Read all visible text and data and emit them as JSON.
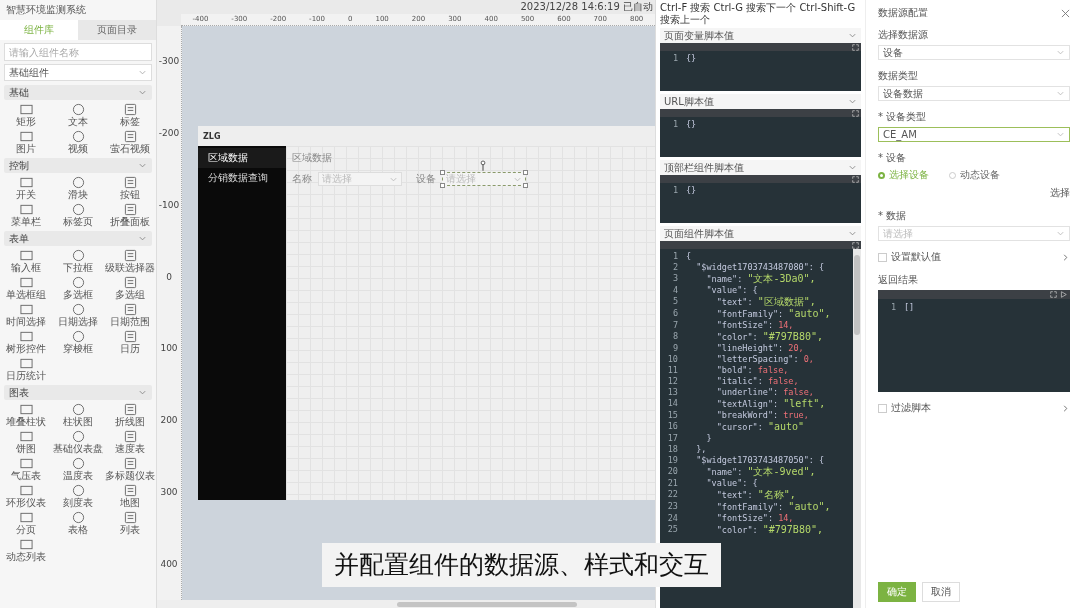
{
  "left_panel": {
    "title": "智慧环境监测系统",
    "tabs": [
      {
        "label": "组件库",
        "selected": true
      },
      {
        "label": "页面目录",
        "selected": false
      }
    ],
    "search": {
      "placeholder": "请输入组件名称"
    },
    "category": {
      "value": "基础组件"
    },
    "sections": [
      {
        "title": "基础",
        "items": [
          "矩形",
          "文本",
          "标签",
          "图片",
          "视频",
          "萤石视频"
        ]
      },
      {
        "title": "控制",
        "items": [
          "开关",
          "滑块",
          "按钮",
          "菜单栏",
          "标签页",
          "折叠面板"
        ]
      },
      {
        "title": "表单",
        "items": [
          "输入框",
          "下拉框",
          "级联选择器",
          "单选框组",
          "多选框",
          "多选组",
          "时间选择",
          "日期选择",
          "日期范围",
          "树形控件",
          "穿梭框",
          "日历",
          "日历统计"
        ]
      },
      {
        "title": "图表",
        "items": [
          "堆叠柱状",
          "柱状图",
          "折线图",
          "饼图",
          "基础仪表盘",
          "速度表",
          "气压表",
          "温度表",
          "多标题仪表",
          "环形仪表",
          "刻度表",
          "地图",
          "分页",
          "表格",
          "列表",
          "动态列表"
        ]
      }
    ]
  },
  "canvas": {
    "timestamp": "2023/12/28 14:6:19 已自动",
    "h_ruler": [
      "-400",
      "-300",
      "-200",
      "-100",
      "0",
      "100",
      "200",
      "300",
      "400",
      "500",
      "600",
      "700",
      "800"
    ],
    "v_ruler": [
      "-300",
      "-200",
      "-100",
      "0",
      "100",
      "200",
      "300",
      "400"
    ],
    "preview": {
      "logo": "ZLG",
      "menu": [
        {
          "label": "区域数据",
          "selected": true
        },
        {
          "label": "分销数据查询",
          "selected": false
        }
      ],
      "heading": "区域数据",
      "fields": [
        {
          "label": "名称",
          "placeholder": "请选择",
          "selected": false
        },
        {
          "label": "设备",
          "placeholder": "请选择",
          "selected": true
        }
      ]
    }
  },
  "script_panel": {
    "hint": "Ctrl-F 搜索 Ctrl-G 搜索下一个 Ctrl-Shift-G 搜索上一个",
    "editors": [
      {
        "title": "页面变量脚本值",
        "lines": [
          {
            "no": "1",
            "code": "{}"
          }
        ]
      },
      {
        "title": "URL脚本值",
        "lines": [
          {
            "no": "1",
            "code": "{}"
          }
        ]
      },
      {
        "title": "顶部栏组件脚本值",
        "lines": [
          {
            "no": "1",
            "code": "{}"
          }
        ]
      },
      {
        "title": "页面组件脚本值",
        "lines": [
          {
            "no": "1",
            "code": "{"
          },
          {
            "no": "2",
            "code": "  \"$widget1703743487080\": {"
          },
          {
            "no": "3",
            "code": "    \"name\": ",
            "value": "\"文本-3Da0\",",
            "kind": "string"
          },
          {
            "no": "4",
            "code": "    \"value\": {"
          },
          {
            "no": "5",
            "code": "      \"text\": ",
            "value": "\"区域数据\",",
            "kind": "string"
          },
          {
            "no": "6",
            "code": "      \"fontFamily\": ",
            "value": "\"auto\",",
            "kind": "string"
          },
          {
            "no": "7",
            "code": "      \"fontSize\": ",
            "value": "14,",
            "kind": "literal"
          },
          {
            "no": "8",
            "code": "      \"color\": ",
            "value": "\"#797B80\",",
            "kind": "string"
          },
          {
            "no": "9",
            "code": "      \"lineHeight\": ",
            "value": "20,",
            "kind": "literal"
          },
          {
            "no": "10",
            "code": "      \"letterSpacing\": ",
            "value": "0,",
            "kind": "literal"
          },
          {
            "no": "11",
            "code": "      \"bold\": ",
            "value": "false,",
            "kind": "literal"
          },
          {
            "no": "12",
            "code": "      \"italic\": ",
            "value": "false,",
            "kind": "literal"
          },
          {
            "no": "13",
            "code": "      \"underline\": ",
            "value": "false,",
            "kind": "literal"
          },
          {
            "no": "14",
            "code": "      \"textAlign\": ",
            "value": "\"left\",",
            "kind": "string"
          },
          {
            "no": "15",
            "code": "      \"breakWord\": ",
            "value": "true,",
            "kind": "literal"
          },
          {
            "no": "16",
            "code": "      \"cursor\": ",
            "value": "\"auto\"",
            "kind": "string"
          },
          {
            "no": "17",
            "code": "    }"
          },
          {
            "no": "18",
            "code": "  },"
          },
          {
            "no": "19",
            "code": "  \"$widget1703743487050\": {"
          },
          {
            "no": "20",
            "code": "    \"name\": ",
            "value": "\"文本-9ved\",",
            "kind": "string"
          },
          {
            "no": "21",
            "code": "    \"value\": {"
          },
          {
            "no": "22",
            "code": "      \"text\": ",
            "value": "\"名称\",",
            "kind": "string"
          },
          {
            "no": "23",
            "code": "      \"fontFamily\": ",
            "value": "\"auto\",",
            "kind": "string"
          },
          {
            "no": "24",
            "code": "      \"fontSize\": ",
            "value": "14,",
            "kind": "literal"
          },
          {
            "no": "25",
            "code": "      \"color\": ",
            "value": "\"#797B80\",",
            "kind": "string"
          }
        ]
      }
    ]
  },
  "config_panel": {
    "title": "数据源配置",
    "fields": [
      {
        "kind": "select",
        "label": "选择数据源",
        "value": "设备",
        "focused": false
      },
      {
        "kind": "select",
        "label": "数据类型",
        "value": "设备数据",
        "focused": false
      },
      {
        "kind": "select",
        "label": "* 设备类型",
        "value": "CE_AM",
        "focused": true
      },
      {
        "kind": "radio",
        "label": "* 设备",
        "options": [
          {
            "label": "选择设备",
            "selected": true
          },
          {
            "label": "动态设备",
            "selected": false
          }
        ],
        "link": "选择"
      },
      {
        "kind": "select",
        "label": "* 数据",
        "placeholder": "请选择",
        "focused": false
      },
      {
        "kind": "checkbox",
        "label": "设置默认值",
        "checked": false
      },
      {
        "kind": "editor",
        "label": "返回结果",
        "lines": [
          {
            "no": "1",
            "code": "[]"
          }
        ]
      },
      {
        "kind": "checkbox",
        "label": "过滤脚本",
        "checked": false
      }
    ],
    "buttons": [
      {
        "label": "确定",
        "kind": "primary"
      },
      {
        "label": "取消",
        "kind": "plain"
      }
    ]
  },
  "caption": "并配置组件的数据源、样式和交互"
}
